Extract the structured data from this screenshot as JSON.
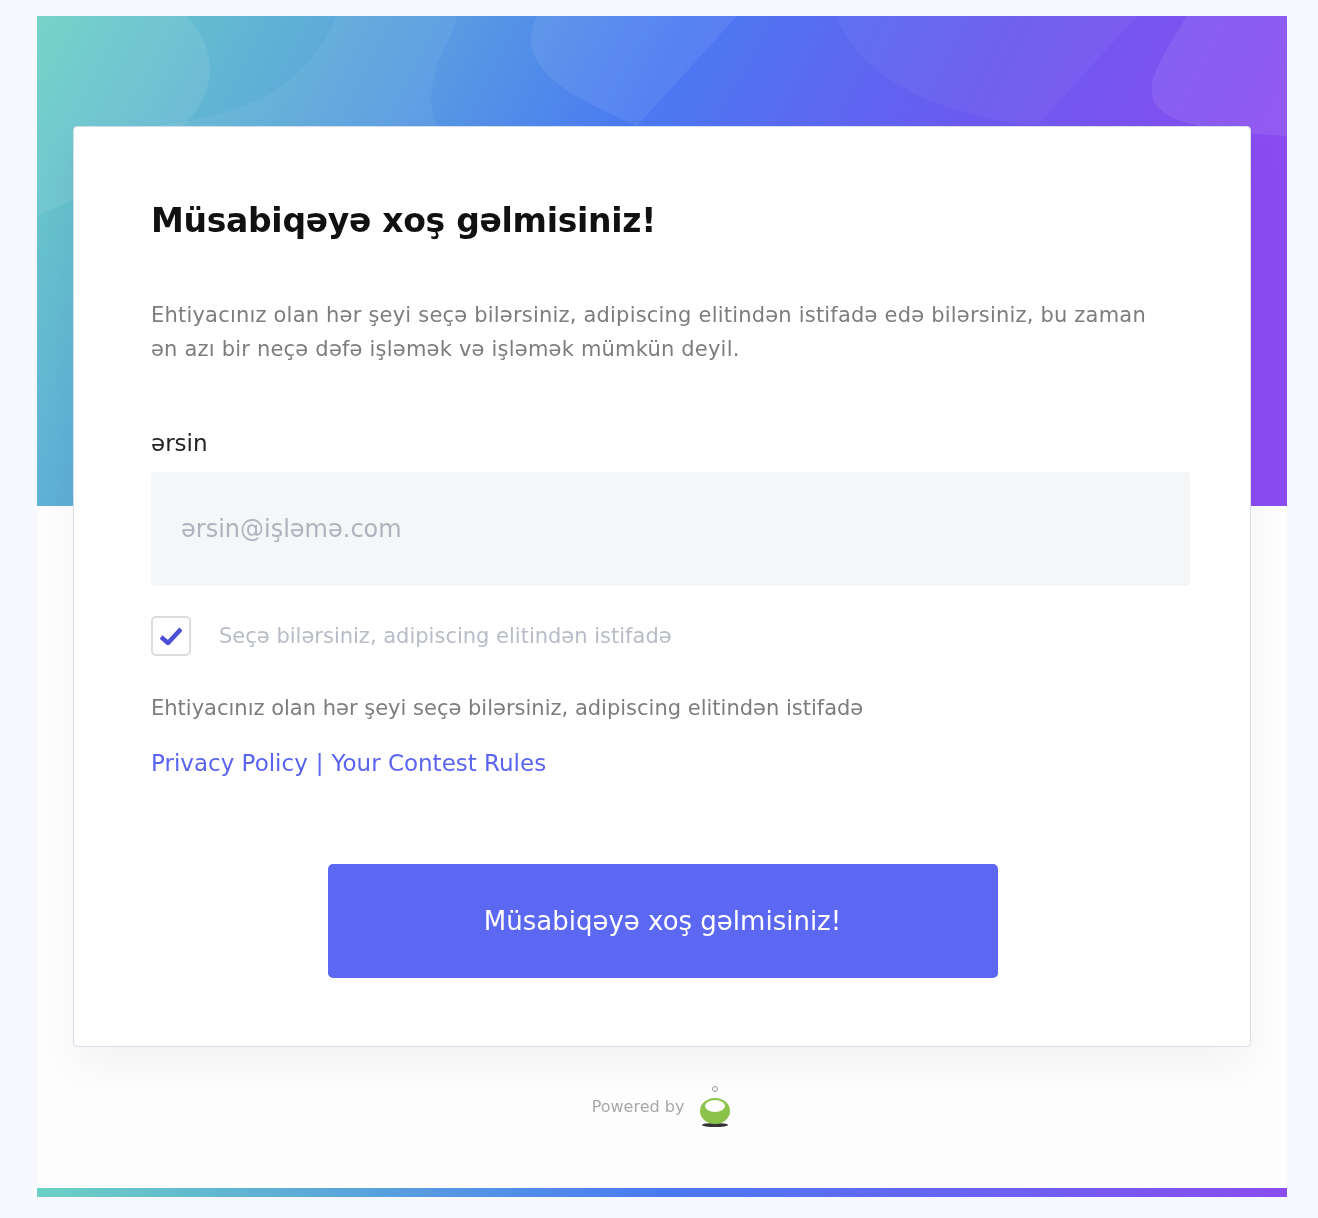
{
  "card": {
    "title": "Müsabiqəyə xoş gəlmisiniz!",
    "intro": "Ehtiyacınız olan hər şeyi seçə bilərsiniz, adipiscing elitindən istifadə edə bilərsiniz, bu zaman ən azı bir neçə dəfə işləmək və işləmək mümkün deyil.",
    "field": {
      "label": "ərsin",
      "placeholder": "ərsin@işləmə.com"
    },
    "consent": {
      "label": "Seçə bilərsiniz, adipiscing elitindən istifadə",
      "checked": true
    },
    "note": "Ehtiyacınız olan hər şeyi seçə bilərsiniz, adipiscing elitindən istifadə",
    "links": [
      {
        "label": "Privacy Policy"
      },
      {
        "label": "Your Contest Rules"
      }
    ],
    "separator": "|",
    "submit": "Müsabiqəyə xoş gəlmisiniz!"
  },
  "footer": {
    "powered_by": "Powered by"
  }
}
